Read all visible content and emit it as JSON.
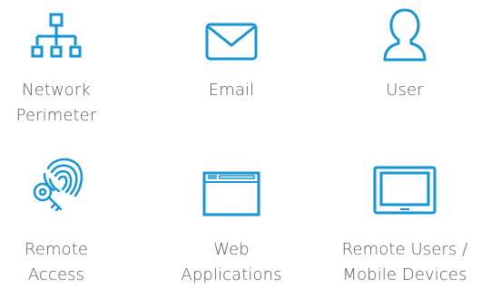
{
  "accent": "#1595d3",
  "items": [
    {
      "icon": "network-icon",
      "lines": [
        "Network",
        "Perimeter"
      ]
    },
    {
      "icon": "email-icon",
      "lines": [
        "Email"
      ]
    },
    {
      "icon": "user-icon",
      "lines": [
        "User"
      ]
    },
    {
      "icon": "fingerprint-key-icon",
      "lines": [
        "Remote",
        "Access"
      ]
    },
    {
      "icon": "browser-window-icon",
      "lines": [
        "Web",
        "Applications"
      ]
    },
    {
      "icon": "laptop-icon",
      "lines": [
        "Remote Users /",
        "Mobile Devices"
      ]
    }
  ]
}
